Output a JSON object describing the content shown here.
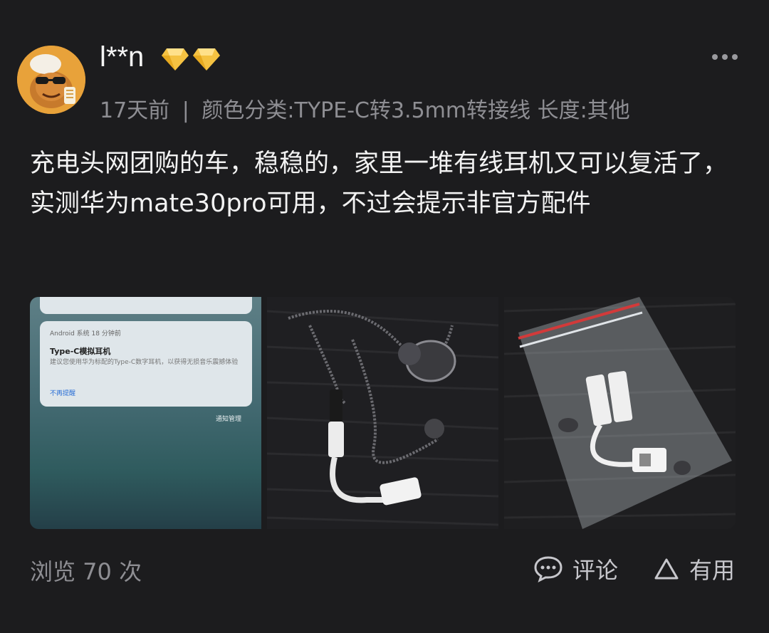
{
  "post": {
    "username": "l**n",
    "time": "17天前",
    "separator": "|",
    "variant": "颜色分类:TYPE-C转3.5mm转接线 长度:其他",
    "content": "充电头网团购的车，稳稳的，家里一堆有线耳机又可以复活了，实测华为mate30pro可用，不过会提示非官方配件"
  },
  "notification": {
    "header": "Android 系统  18 分钟前",
    "title": "Type-C模拟耳机",
    "body": "建议您使用华为标配的Type-C数字耳机，以获得无损音乐震撼体验",
    "dismiss": "不再提醒",
    "manage": "通知管理"
  },
  "footer": {
    "views": "浏览 70 次",
    "comment_label": "评论",
    "useful_label": "有用"
  },
  "icons": {
    "more": "more-dots-icon",
    "diamond": "diamond-badge-icon",
    "comment": "comment-bubble-icon",
    "useful": "triangle-up-icon"
  },
  "colors": {
    "background": "#1c1c1e",
    "text_primary": "#f2f2f2",
    "text_secondary": "#8e8e93",
    "badge_gold": "#f5c242"
  }
}
